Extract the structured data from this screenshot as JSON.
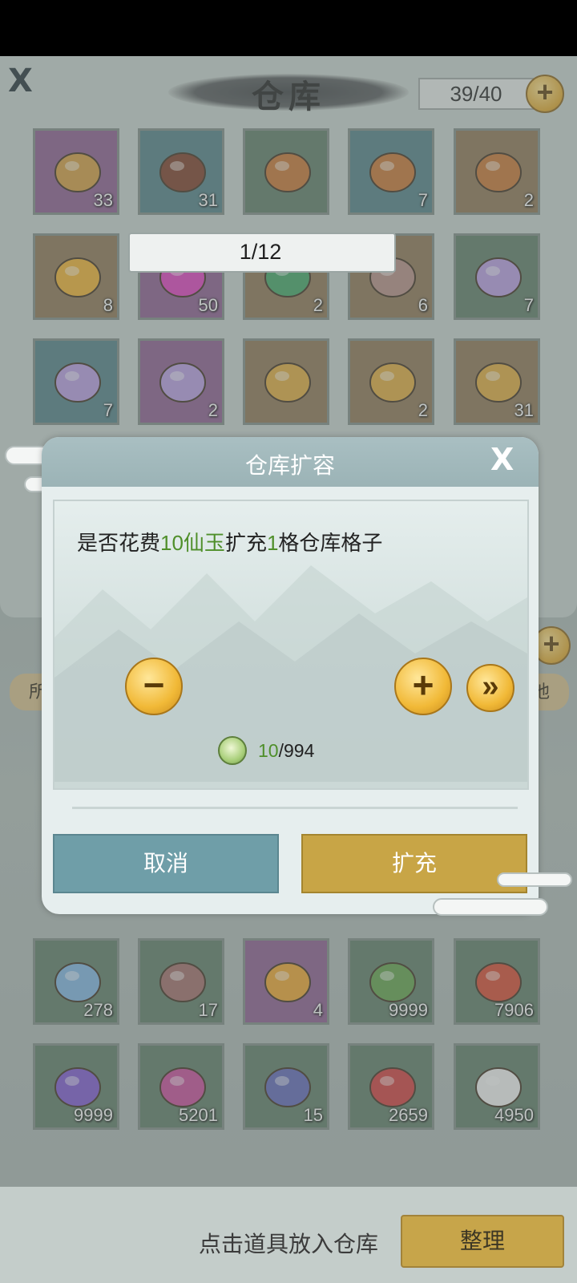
{
  "warehouse": {
    "title": "仓库",
    "capacity": "39/40",
    "add_label": "+",
    "close_label": "X"
  },
  "top_slots": [
    {
      "icon": "scroll-book-icon",
      "count": "33",
      "bg": "purple"
    },
    {
      "icon": "clay-jar-icon",
      "count": "31",
      "bg": "teal"
    },
    {
      "icon": "jade-treasure-chest-icon",
      "count": "",
      "bg": "green"
    },
    {
      "icon": "jade-treasure-chest-icon",
      "count": "7",
      "bg": "teal"
    },
    {
      "icon": "jade-treasure-chest-icon",
      "count": "2",
      "bg": "brown"
    },
    {
      "icon": "golden-orb-icon",
      "count": "8",
      "bg": "brown"
    },
    {
      "icon": "pink-droplet-gem-icon",
      "count": "50",
      "bg": "purple"
    },
    {
      "icon": "green-crystal-icon",
      "count": "2",
      "bg": "brown"
    },
    {
      "icon": "cosmetic-box-icon",
      "count": "6",
      "bg": "brown"
    },
    {
      "icon": "purple-butterfly-icon",
      "count": "7",
      "bg": "green"
    },
    {
      "icon": "purple-butterfly-icon",
      "count": "7",
      "bg": "teal"
    },
    {
      "icon": "purple-butterfly-icon",
      "count": "2",
      "bg": "purple"
    },
    {
      "icon": "golden-chest-icon",
      "count": "",
      "bg": "brown"
    },
    {
      "icon": "golden-chest-icon",
      "count": "2",
      "bg": "brown"
    },
    {
      "icon": "golden-chest-icon",
      "count": "31",
      "bg": "brown"
    }
  ],
  "bag_slots": [
    {
      "icon": "blue-rune-stone-icon",
      "count": "278",
      "bg": "green"
    },
    {
      "icon": "crystal-ball-icon",
      "count": "17",
      "bg": "green"
    },
    {
      "icon": "golden-amber-orb-icon",
      "count": "4",
      "bg": "purple"
    },
    {
      "icon": "green-herb-icon",
      "count": "9999",
      "bg": "green"
    },
    {
      "icon": "red-berry-herb-icon",
      "count": "7906",
      "bg": "green"
    },
    {
      "icon": "purple-lily-icon",
      "count": "9999",
      "bg": "green"
    },
    {
      "icon": "pink-star-flower-icon",
      "count": "5201",
      "bg": "green"
    },
    {
      "icon": "blue-berries-icon",
      "count": "15",
      "bg": "green"
    },
    {
      "icon": "red-flower-herb-icon",
      "count": "2659",
      "bg": "green"
    },
    {
      "icon": "white-lily-icon",
      "count": "4950",
      "bg": "green"
    }
  ],
  "side_tabs": {
    "left": "所",
    "right": "他"
  },
  "dialog": {
    "title": "仓库扩容",
    "message_pre": "是否花费",
    "message_cost": "10仙玉",
    "message_mid": "扩充",
    "message_num": "1",
    "message_post": "格仓库格子",
    "stepper_value": "1/12",
    "minus_label": "−",
    "plus_label": "+",
    "max_label": "»",
    "cost_spent": "10",
    "cost_total": "/994",
    "cancel_label": "取消",
    "confirm_label": "扩充"
  },
  "footer": {
    "hint": "点击道具放入仓库",
    "sort_label": "整理"
  },
  "colors": {
    "highlight_green": "#4f8f2a",
    "gold_button": "#c8a546",
    "teal_button": "#6f9ea8"
  }
}
